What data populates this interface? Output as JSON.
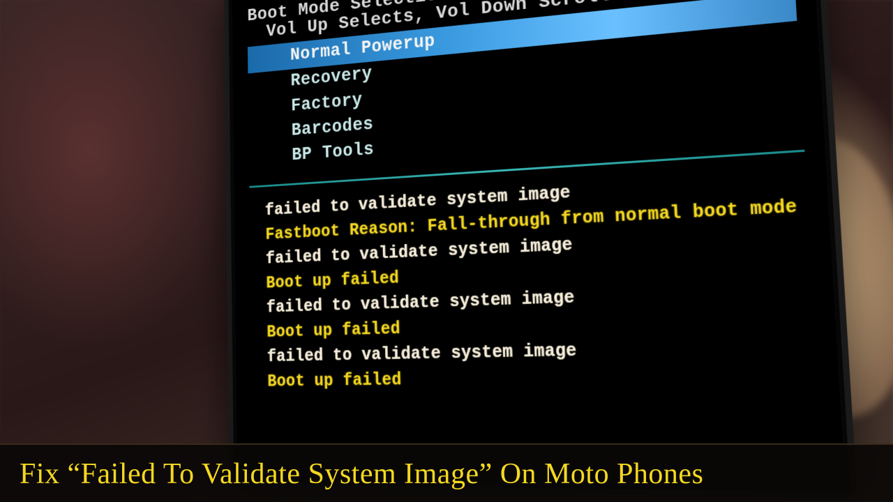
{
  "boot": {
    "title": "Boot Mode Selection Menu",
    "instructions": "Vol Up Selects, Vol Down Scrolls",
    "menu": [
      {
        "label": "Normal Powerup",
        "selected": true
      },
      {
        "label": "Recovery",
        "selected": false
      },
      {
        "label": "Factory",
        "selected": false
      },
      {
        "label": "Barcodes",
        "selected": false
      },
      {
        "label": "BP Tools",
        "selected": false
      }
    ],
    "log": [
      {
        "text": "failed to validate system image",
        "style": "white"
      },
      {
        "text": "Fastboot Reason: Fall-through from normal boot mode",
        "style": "yellow"
      },
      {
        "text": "failed to validate system image",
        "style": "white"
      },
      {
        "text": "Boot up failed",
        "style": "yellow"
      },
      {
        "text": "failed to validate system image",
        "style": "white"
      },
      {
        "text": "Boot up failed",
        "style": "yellow"
      },
      {
        "text": "failed to validate system image",
        "style": "white"
      },
      {
        "text": "Boot up failed",
        "style": "yellow"
      }
    ]
  },
  "caption": "Fix “Failed To Validate System Image” On Moto Phones"
}
